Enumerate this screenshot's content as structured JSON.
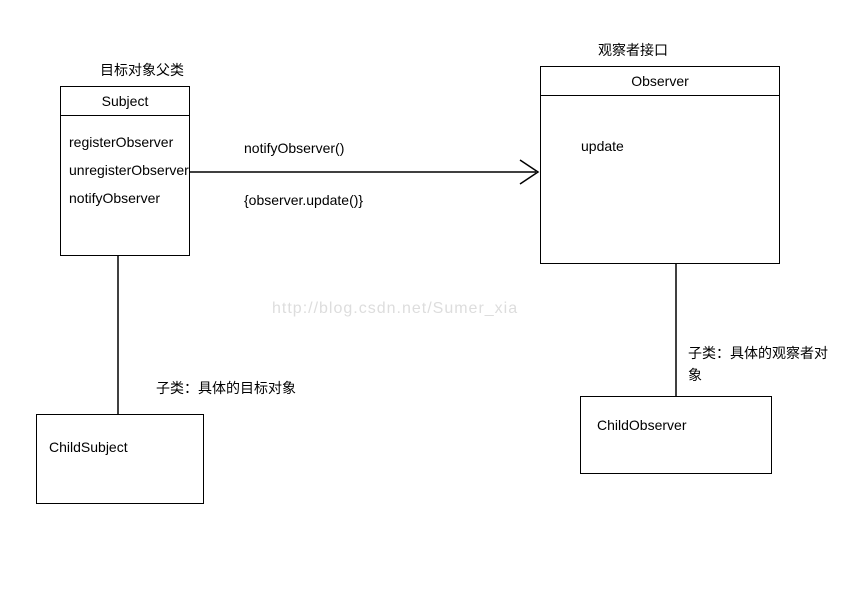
{
  "labels": {
    "subject_parent": "目标对象父类",
    "observer_interface": "观察者接口",
    "child_subject_note": "子类：具体的目标对象",
    "child_observer_note": "子类：具体的观察者对象"
  },
  "subject": {
    "title": "Subject",
    "methods": {
      "m1": "registerObserver",
      "m2": "unregisterObserver",
      "m3": "notifyObserver"
    }
  },
  "observer": {
    "title": "Observer",
    "method": "update"
  },
  "child_subject": {
    "title": "ChildSubject"
  },
  "child_observer": {
    "title": "ChildObserver"
  },
  "arrow": {
    "label_top": "notifyObserver()",
    "label_bottom": "{observer.update()}"
  },
  "watermark": "http://blog.csdn.net/Sumer_xia"
}
